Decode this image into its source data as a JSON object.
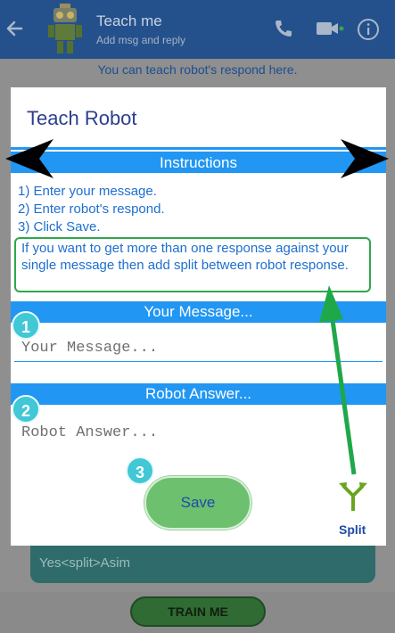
{
  "appbar": {
    "title": "Teach me",
    "subtitle": "Add msg and reply",
    "icons": [
      "back-arrow-icon",
      "robot-avatar",
      "phone-icon",
      "video-icon",
      "info-icon"
    ]
  },
  "hint_text": "You can teach robot's respond here.",
  "background_message": "Yes<split>Asim",
  "train_button": "TRAIN ME",
  "dialog": {
    "title": "Teach Robot",
    "instructions_header": "Instructions",
    "steps": [
      "1) Enter your message.",
      "2) Enter robot's respond.",
      "3) Click Save."
    ],
    "note": "If you want to get more than one response against your single message then add split between robot response.",
    "message_header": "Your Message...",
    "message_placeholder": "Your Message...",
    "answer_header": "Robot Answer...",
    "answer_placeholder": "Robot Answer...",
    "badges": [
      "1",
      "2",
      "3"
    ],
    "save_label": "Save",
    "split_label": "Split"
  },
  "colors": {
    "accent_blue": "#2196f3",
    "note_border_green": "#2ea84a",
    "save_green": "#6cc06e",
    "badge_cyan": "#41c7d6"
  }
}
